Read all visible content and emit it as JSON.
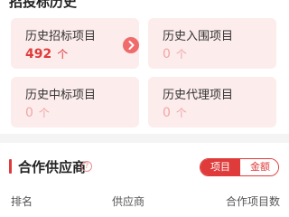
{
  "section1": {
    "title": "招投标历史",
    "tiles": [
      {
        "label": "历史招标项目",
        "value": "492",
        "unit": "个"
      },
      {
        "label": "历史入围项目",
        "value": "0",
        "unit": "个"
      },
      {
        "label": "历史中标项目",
        "value": "0",
        "unit": "个"
      },
      {
        "label": "历史代理项目",
        "value": "0",
        "unit": "个"
      }
    ]
  },
  "section2": {
    "title": "合作供应商",
    "help": "?",
    "toggle": {
      "active": "项目",
      "inactive": "金额"
    },
    "columns": [
      "排名",
      "供应商",
      "合作项目数"
    ]
  },
  "colors": {
    "accent": "#e03b3b",
    "tile_bg": "#fdecec",
    "muted_number": "#f0a6a6"
  },
  "icons": [
    "chevron-right-icon",
    "help-circle-icon"
  ]
}
